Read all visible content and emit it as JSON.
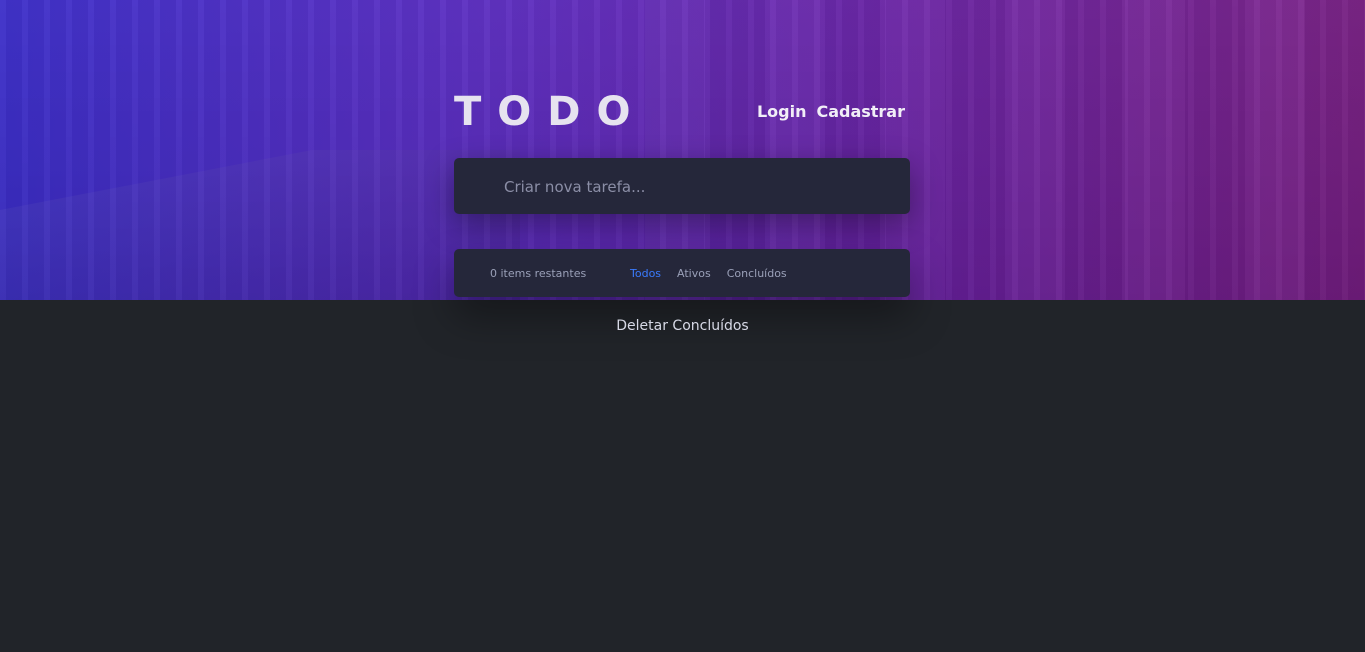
{
  "app": {
    "title": "TODO"
  },
  "nav": {
    "login": "Login",
    "signup": "Cadastrar"
  },
  "new_task": {
    "placeholder": "Criar nova tarefa..."
  },
  "footer": {
    "items_left": "0 items restantes",
    "filters": [
      "Todos",
      "Ativos",
      "Concluídos"
    ],
    "active_filter": "Todos"
  },
  "clear_completed": "Deletar Concluídos",
  "colors": {
    "accent": "#3a7bfd",
    "panel": "#25273a",
    "background": "#212429"
  }
}
